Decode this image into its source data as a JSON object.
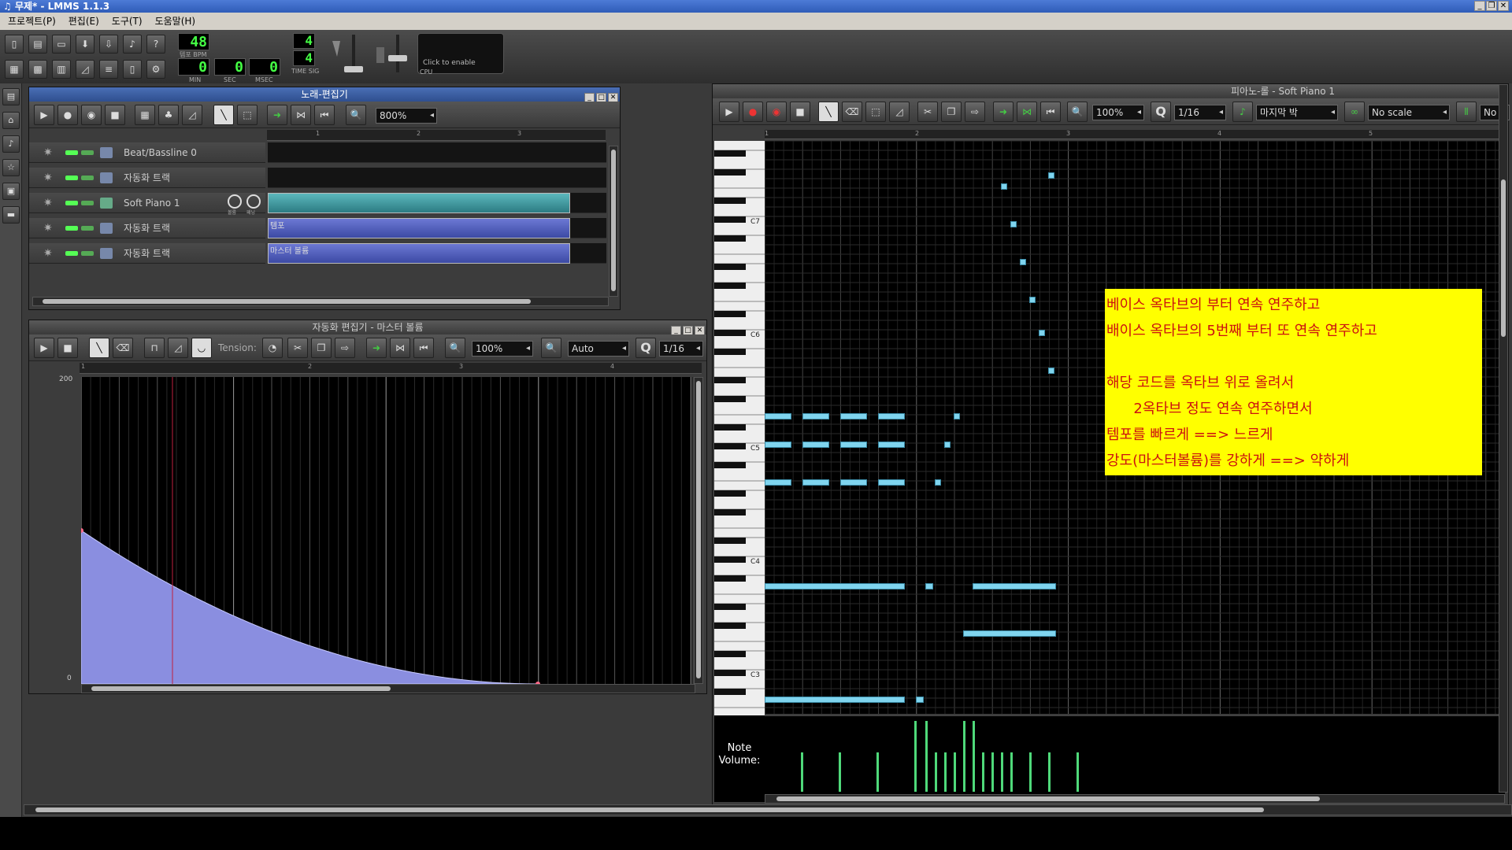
{
  "window": {
    "title": "무제* - LMMS 1.1.3"
  },
  "menu": [
    "프로젝트(P)",
    "편집(E)",
    "도구(T)",
    "도움말(H)"
  ],
  "toolbar": {
    "tempo": "48",
    "tempo_label": "템포 BPM",
    "min": "0",
    "sec": "0",
    "msec": "0",
    "min_label": "MIN",
    "sec_label": "SEC",
    "msec_label": "MSEC",
    "timesig_top": "4",
    "timesig_bottom": "4",
    "timesig_label": "TIME SIG",
    "cpu_text": "Click to enable",
    "cpu_label": "CPU"
  },
  "song_editor": {
    "title": "노래-편집기",
    "zoom": "800%",
    "tracks": [
      {
        "name": "Beat/Bassline 0"
      },
      {
        "name": "자동화 트랙"
      },
      {
        "name": "Soft Piano 1"
      },
      {
        "name": "자동화 트랙"
      },
      {
        "name": "자동화 트랙"
      }
    ],
    "patterns": [
      "템포",
      "마스터 볼륨"
    ],
    "ruler": [
      "1",
      "2",
      "3"
    ],
    "knob_labels": [
      "볼륨",
      "패닝"
    ]
  },
  "automation_editor": {
    "title": "자동화 편집기 - 마스터 볼륨",
    "tension_label": "Tension:",
    "zoom": "100%",
    "quant_mode": "Auto",
    "quant": "1/16",
    "ymax": "200",
    "ymin": "0",
    "ruler": [
      "1",
      "2",
      "3",
      "4"
    ],
    "curve": {
      "start": 100,
      "end": 0
    }
  },
  "piano_roll": {
    "title": "피아노-롤 - Soft Piano 1",
    "zoom": "100%",
    "quant": "1/16",
    "note_len": "마지막 박",
    "scale": "No scale",
    "chord": "No c",
    "octaves": [
      "C7",
      "C6",
      "C5",
      "C4",
      "C3"
    ],
    "ruler": [
      "1",
      "2",
      "3",
      "4",
      "5"
    ],
    "volume_label": "Note\nVolume:"
  },
  "annotation": {
    "lines": [
      "베이스 옥타브의 부터 연속 연주하고",
      "배이스 옥타브의 5번째 부터 또 연속 연주하고",
      "",
      "해당 코드를 옥타브 위로 올려서",
      "      2옥타브 정도 연속 연주하면서",
      "템포를 빠르게 ==> 느르게",
      "강도(마스터볼륨)를 강하게 ==> 약하게"
    ]
  },
  "colors": {
    "titlebar": "#2f5cb8",
    "note": "#7fd4ee",
    "velocity": "#4fd97a",
    "annotation_bg": "#ffff00",
    "annotation_text": "#cc1010",
    "automation_fill": "#8a8ee0"
  }
}
